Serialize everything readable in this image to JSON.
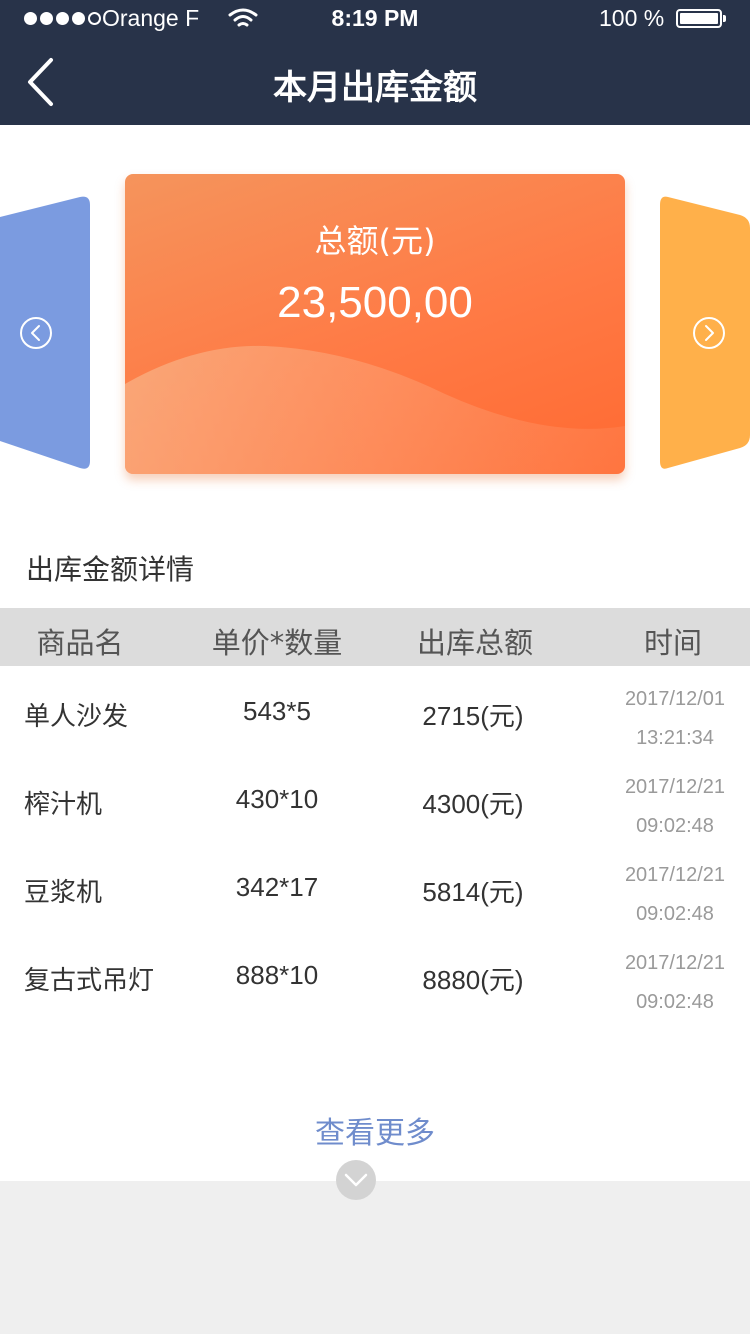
{
  "status_bar": {
    "carrier": "Orange F",
    "time": "8:19 PM",
    "battery": "100 %"
  },
  "nav": {
    "title": "本月出库金额",
    "back_icon": "chevron-left-icon"
  },
  "summary_card": {
    "label": "总额(元)",
    "value": "23,500,00",
    "prev_icon": "circle-chevron-left-icon",
    "next_icon": "circle-chevron-right-icon"
  },
  "details": {
    "section_title": "出库金额详情",
    "columns": [
      "商品名",
      "单价*数量",
      "出库总额",
      "时间"
    ],
    "rows": [
      {
        "name": "单人沙发",
        "qty": "543*5",
        "amount": "2715(元)",
        "date": "2017/12/01",
        "time": "13:21:34"
      },
      {
        "name": "榨汁机",
        "qty": "430*10",
        "amount": "4300(元)",
        "date": "2017/12/21",
        "time": "09:02:48"
      },
      {
        "name": "豆浆机",
        "qty": "342*17",
        "amount": "5814(元)",
        "date": "2017/12/21",
        "time": "09:02:48"
      },
      {
        "name": "复古式吊灯",
        "qty": "888*10",
        "amount": "8880(元)",
        "date": "2017/12/21",
        "time": "09:02:48"
      }
    ],
    "more_label": "查看更多",
    "more_icon": "chevron-down-icon"
  },
  "colors": {
    "nav_bg": "#283349",
    "card_center": "#ff7a45",
    "card_left": "#7b9be0",
    "card_right": "#ffb04a",
    "link": "#6f8ccc",
    "table_header_bg": "#dcdcdc"
  }
}
